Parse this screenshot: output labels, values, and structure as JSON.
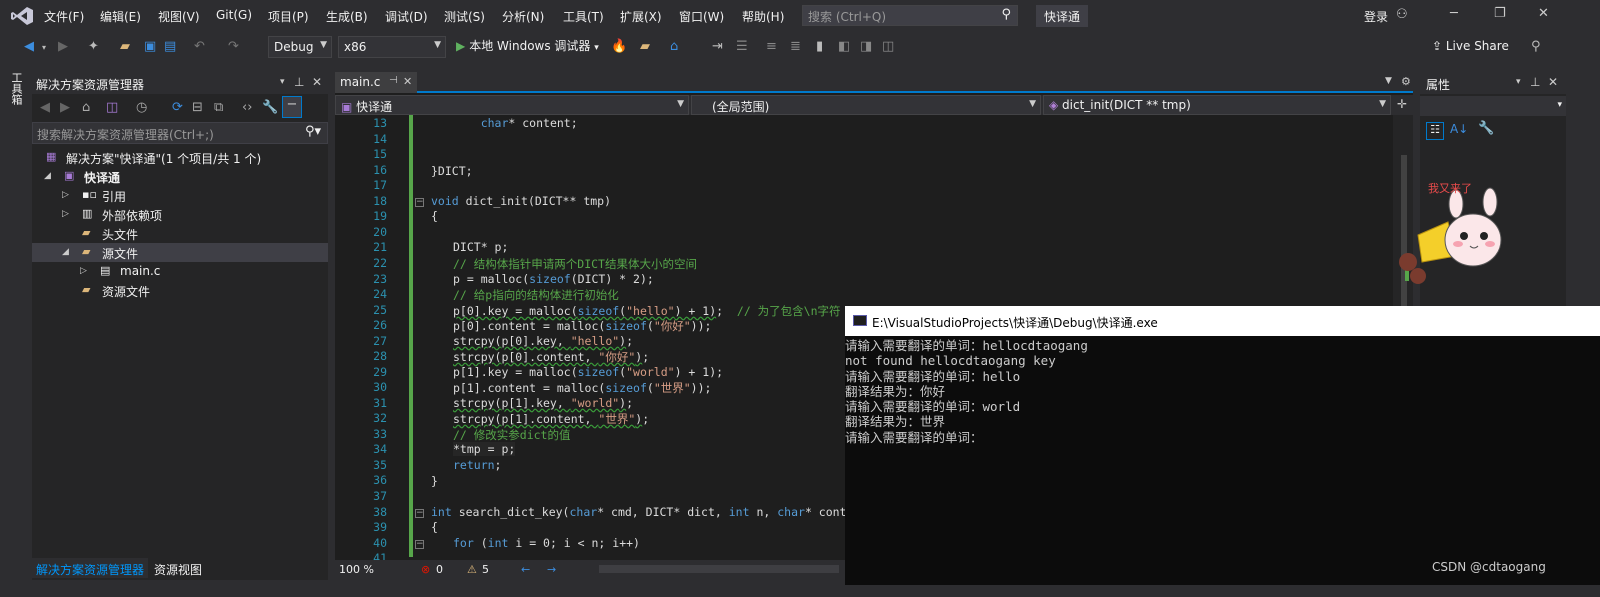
{
  "menu": [
    "文件(F)",
    "编辑(E)",
    "视图(V)",
    "Git(G)",
    "项目(P)",
    "生成(B)",
    "调试(D)",
    "测试(S)",
    "分析(N)",
    "工具(T)",
    "扩展(X)",
    "窗口(W)",
    "帮助(H)"
  ],
  "search_placeholder": "搜索 (Ctrl+Q)",
  "app_name": "快译通",
  "login_label": "登录",
  "toolbar": {
    "config": "Debug",
    "platform": "x86",
    "run_label": "本地 Windows 调试器",
    "live_share": "Live Share"
  },
  "left_strip_label": "工具箱",
  "solution_explorer": {
    "title": "解决方案资源管理器",
    "search_placeholder": "搜索解决方案资源管理器(Ctrl+;)",
    "tree": [
      {
        "label": "解决方案\"快译通\"(1 个项目/共 1 个)",
        "icon": "solution-icon"
      },
      {
        "label": "快译通",
        "icon": "project-icon"
      },
      {
        "label": "引用",
        "icon": "references-icon"
      },
      {
        "label": "外部依赖项",
        "icon": "external-deps-icon"
      },
      {
        "label": "头文件",
        "icon": "folder-icon"
      },
      {
        "label": "源文件",
        "icon": "folder-icon"
      },
      {
        "label": "main.c",
        "icon": "c-file-icon"
      },
      {
        "label": "资源文件",
        "icon": "folder-icon"
      }
    ],
    "tabs": [
      "解决方案资源管理器",
      "资源视图"
    ]
  },
  "editor": {
    "tab_label": "main.c",
    "nav_project": "快译通",
    "nav_scope": "(全局范围)",
    "nav_member": "dict_init(DICT ** tmp)",
    "line_numbers": [
      "13",
      "14",
      "15",
      "16",
      "17",
      "18",
      "19",
      "20",
      "21",
      "22",
      "23",
      "24",
      "25",
      "26",
      "27",
      "28",
      "29",
      "30",
      "31",
      "32",
      "33",
      "34",
      "35",
      "36",
      "37",
      "38",
      "39",
      "40",
      "41"
    ],
    "zoom": "100 %",
    "errors": "0",
    "warnings": "5"
  },
  "properties": {
    "title": "属性"
  },
  "console": {
    "title": "E:\\VisualStudioProjects\\快译通\\Debug\\快译通.exe",
    "lines": [
      "请输入需要翻译的单词：hellocdtaogang",
      "not found hellocdtaogang key",
      "请输入需要翻译的单词：hello",
      "翻译结果为：你好",
      "请输入需要翻译的单词：world",
      "翻译结果为：世界",
      "请输入需要翻译的单词："
    ]
  },
  "watermark": "CSDN @cdtaogang",
  "colors": {
    "accent": "#007acc",
    "background": "#1e1e1e",
    "console_bg": "#0c0c0c"
  }
}
